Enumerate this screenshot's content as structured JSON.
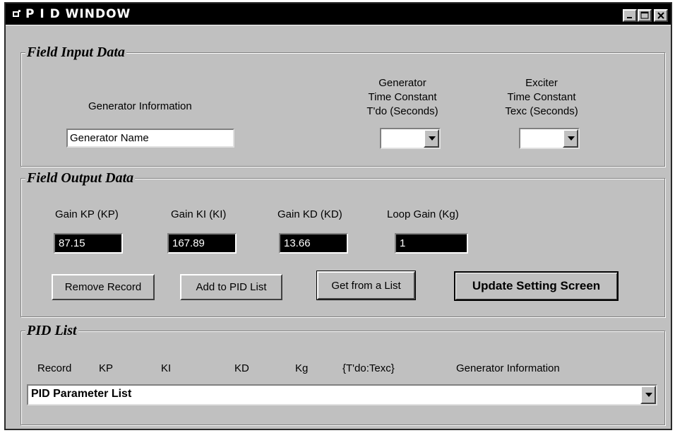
{
  "window": {
    "title": "P I D WINDOW"
  },
  "field_input": {
    "title": "Field Input Data",
    "generator_info_label": "Generator Information",
    "generator_name_value": "Generator Name",
    "generator_tc_label_1": "Generator",
    "generator_tc_label_2": "Time Constant",
    "generator_tc_label_3": "T'do (Seconds)",
    "generator_tc_value": "",
    "exciter_tc_label_1": "Exciter",
    "exciter_tc_label_2": "Time Constant",
    "exciter_tc_label_3": "Texc (Seconds)",
    "exciter_tc_value": ""
  },
  "field_output": {
    "title": "Field Output Data",
    "kp_label": "Gain KP (KP)",
    "kp_value": "87.15",
    "ki_label": "Gain KI (KI)",
    "ki_value": "167.89",
    "kd_label": "Gain KD (KD)",
    "kd_value": "13.66",
    "kg_label": "Loop Gain (Kg)",
    "kg_value": "1",
    "remove_record": "Remove Record",
    "add_to_pid_list": "Add to PID List",
    "get_from_list": "Get from a List",
    "update_setting_screen": "Update Setting Screen"
  },
  "pid_list": {
    "title": "PID List",
    "columns": [
      "Record",
      "KP",
      "KI",
      "KD",
      "Kg",
      "{T'do:Texc}",
      "Generator Information"
    ],
    "selected": "PID Parameter List"
  },
  "icons": {
    "app": "window-app-icon",
    "minimize": "minimize-icon",
    "maximize": "maximize-icon",
    "close": "close-icon",
    "dropdown": "chevron-down-icon"
  }
}
